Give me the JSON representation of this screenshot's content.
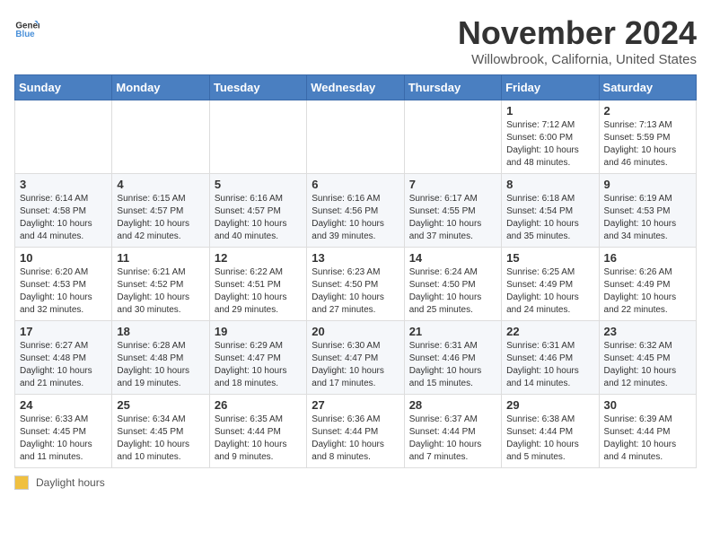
{
  "header": {
    "logo_general": "General",
    "logo_blue": "Blue",
    "month_title": "November 2024",
    "location": "Willowbrook, California, United States"
  },
  "legend": {
    "label": "Daylight hours"
  },
  "days_of_week": [
    "Sunday",
    "Monday",
    "Tuesday",
    "Wednesday",
    "Thursday",
    "Friday",
    "Saturday"
  ],
  "weeks": [
    {
      "days": [
        {
          "number": "",
          "info": ""
        },
        {
          "number": "",
          "info": ""
        },
        {
          "number": "",
          "info": ""
        },
        {
          "number": "",
          "info": ""
        },
        {
          "number": "",
          "info": ""
        },
        {
          "number": "1",
          "info": "Sunrise: 7:12 AM\nSunset: 6:00 PM\nDaylight: 10 hours and 48 minutes."
        },
        {
          "number": "2",
          "info": "Sunrise: 7:13 AM\nSunset: 5:59 PM\nDaylight: 10 hours and 46 minutes."
        }
      ]
    },
    {
      "days": [
        {
          "number": "3",
          "info": "Sunrise: 6:14 AM\nSunset: 4:58 PM\nDaylight: 10 hours and 44 minutes."
        },
        {
          "number": "4",
          "info": "Sunrise: 6:15 AM\nSunset: 4:57 PM\nDaylight: 10 hours and 42 minutes."
        },
        {
          "number": "5",
          "info": "Sunrise: 6:16 AM\nSunset: 4:57 PM\nDaylight: 10 hours and 40 minutes."
        },
        {
          "number": "6",
          "info": "Sunrise: 6:16 AM\nSunset: 4:56 PM\nDaylight: 10 hours and 39 minutes."
        },
        {
          "number": "7",
          "info": "Sunrise: 6:17 AM\nSunset: 4:55 PM\nDaylight: 10 hours and 37 minutes."
        },
        {
          "number": "8",
          "info": "Sunrise: 6:18 AM\nSunset: 4:54 PM\nDaylight: 10 hours and 35 minutes."
        },
        {
          "number": "9",
          "info": "Sunrise: 6:19 AM\nSunset: 4:53 PM\nDaylight: 10 hours and 34 minutes."
        }
      ]
    },
    {
      "days": [
        {
          "number": "10",
          "info": "Sunrise: 6:20 AM\nSunset: 4:53 PM\nDaylight: 10 hours and 32 minutes."
        },
        {
          "number": "11",
          "info": "Sunrise: 6:21 AM\nSunset: 4:52 PM\nDaylight: 10 hours and 30 minutes."
        },
        {
          "number": "12",
          "info": "Sunrise: 6:22 AM\nSunset: 4:51 PM\nDaylight: 10 hours and 29 minutes."
        },
        {
          "number": "13",
          "info": "Sunrise: 6:23 AM\nSunset: 4:50 PM\nDaylight: 10 hours and 27 minutes."
        },
        {
          "number": "14",
          "info": "Sunrise: 6:24 AM\nSunset: 4:50 PM\nDaylight: 10 hours and 25 minutes."
        },
        {
          "number": "15",
          "info": "Sunrise: 6:25 AM\nSunset: 4:49 PM\nDaylight: 10 hours and 24 minutes."
        },
        {
          "number": "16",
          "info": "Sunrise: 6:26 AM\nSunset: 4:49 PM\nDaylight: 10 hours and 22 minutes."
        }
      ]
    },
    {
      "days": [
        {
          "number": "17",
          "info": "Sunrise: 6:27 AM\nSunset: 4:48 PM\nDaylight: 10 hours and 21 minutes."
        },
        {
          "number": "18",
          "info": "Sunrise: 6:28 AM\nSunset: 4:48 PM\nDaylight: 10 hours and 19 minutes."
        },
        {
          "number": "19",
          "info": "Sunrise: 6:29 AM\nSunset: 4:47 PM\nDaylight: 10 hours and 18 minutes."
        },
        {
          "number": "20",
          "info": "Sunrise: 6:30 AM\nSunset: 4:47 PM\nDaylight: 10 hours and 17 minutes."
        },
        {
          "number": "21",
          "info": "Sunrise: 6:31 AM\nSunset: 4:46 PM\nDaylight: 10 hours and 15 minutes."
        },
        {
          "number": "22",
          "info": "Sunrise: 6:31 AM\nSunset: 4:46 PM\nDaylight: 10 hours and 14 minutes."
        },
        {
          "number": "23",
          "info": "Sunrise: 6:32 AM\nSunset: 4:45 PM\nDaylight: 10 hours and 12 minutes."
        }
      ]
    },
    {
      "days": [
        {
          "number": "24",
          "info": "Sunrise: 6:33 AM\nSunset: 4:45 PM\nDaylight: 10 hours and 11 minutes."
        },
        {
          "number": "25",
          "info": "Sunrise: 6:34 AM\nSunset: 4:45 PM\nDaylight: 10 hours and 10 minutes."
        },
        {
          "number": "26",
          "info": "Sunrise: 6:35 AM\nSunset: 4:44 PM\nDaylight: 10 hours and 9 minutes."
        },
        {
          "number": "27",
          "info": "Sunrise: 6:36 AM\nSunset: 4:44 PM\nDaylight: 10 hours and 8 minutes."
        },
        {
          "number": "28",
          "info": "Sunrise: 6:37 AM\nSunset: 4:44 PM\nDaylight: 10 hours and 7 minutes."
        },
        {
          "number": "29",
          "info": "Sunrise: 6:38 AM\nSunset: 4:44 PM\nDaylight: 10 hours and 5 minutes."
        },
        {
          "number": "30",
          "info": "Sunrise: 6:39 AM\nSunset: 4:44 PM\nDaylight: 10 hours and 4 minutes."
        }
      ]
    }
  ]
}
